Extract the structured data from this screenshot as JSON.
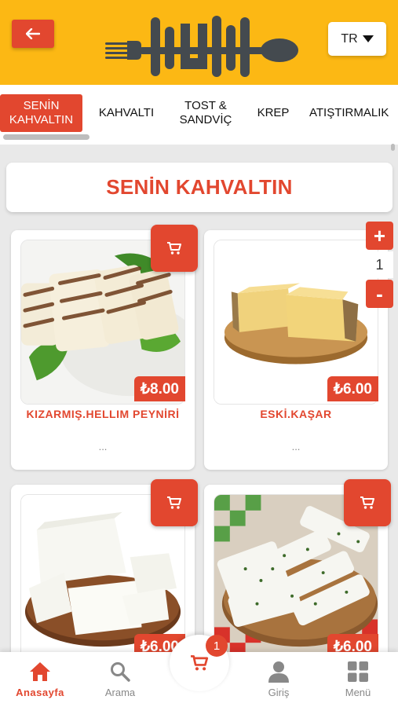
{
  "header": {
    "back_icon": "arrow-left-icon",
    "logo_icon": "fork-knife-logo-icon",
    "language": "TR",
    "language_icon": "caret-down-icon",
    "accent_color": "#fcb814",
    "brand_color": "#e2472f"
  },
  "tabs": [
    {
      "label": "SENİN\nKAHVALTIN",
      "active": true
    },
    {
      "label": "KAHVALTI",
      "active": false
    },
    {
      "label": "TOST &\nSANDVİÇ",
      "active": false
    },
    {
      "label": "KREP",
      "active": false
    },
    {
      "label": "ATIŞTIRMALIK",
      "active": false
    }
  ],
  "section": {
    "title": "SENİN KAHVALTIN"
  },
  "products": [
    {
      "name": "KIZARMIŞ.HELLIM PEYNİRİ",
      "price": "₺8.00",
      "desc": "...",
      "image": "grilled-halloumi-image",
      "cart_icon": "cart-icon"
    },
    {
      "name": "ESKİ.KAŞAR",
      "price": "₺6.00",
      "desc": "...",
      "image": "aged-kashar-cheese-image",
      "cart_icon": "cart-icon",
      "quantity": "1"
    },
    {
      "name": "",
      "price": "₺6.00",
      "image": "white-cheese-image",
      "cart_icon": "cart-icon"
    },
    {
      "name": "",
      "price": "₺6.00",
      "image": "herb-cheese-image",
      "cart_icon": "cart-icon"
    }
  ],
  "stepper": {
    "plus": "+",
    "minus": "-",
    "value": "1"
  },
  "bottom_nav": {
    "items": [
      {
        "label": "Anasayfa",
        "icon": "home-icon",
        "active": true
      },
      {
        "label": "Arama",
        "icon": "search-icon",
        "active": false
      },
      {
        "label": "Giriş",
        "icon": "user-icon",
        "active": false
      },
      {
        "label": "Menü",
        "icon": "grid-icon",
        "active": false
      }
    ],
    "cart_count": "1",
    "cart_icon": "cart-icon"
  }
}
